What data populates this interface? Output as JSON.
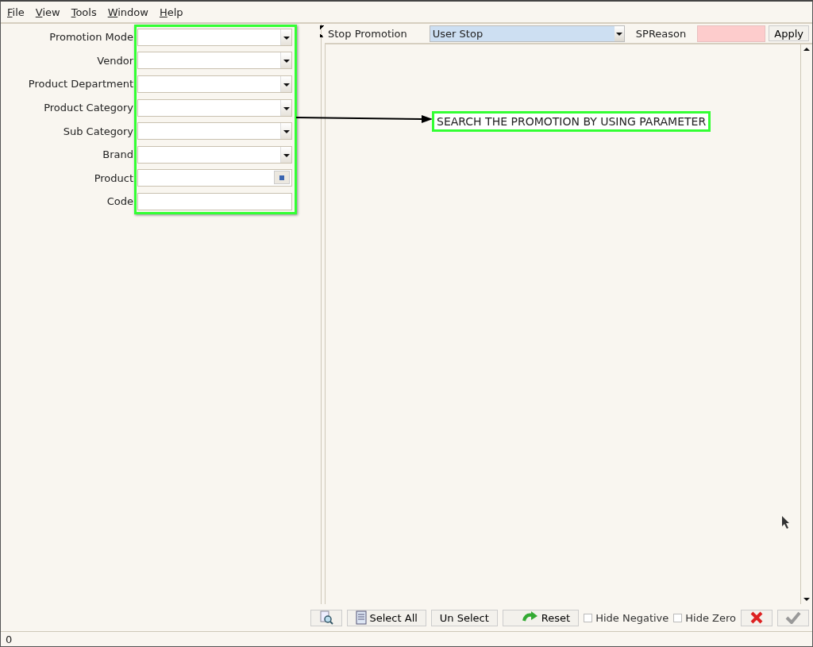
{
  "menu": [
    "File",
    "View",
    "Tools",
    "Window",
    "Help"
  ],
  "filters": [
    {
      "label": "Promotion Mode",
      "kind": "dropdown"
    },
    {
      "label": "Vendor",
      "kind": "dropdown"
    },
    {
      "label": "Product Department",
      "kind": "dropdown"
    },
    {
      "label": "Product Category",
      "kind": "dropdown"
    },
    {
      "label": "Sub Category",
      "kind": "dropdown"
    },
    {
      "label": "Brand",
      "kind": "dropdown"
    },
    {
      "label": "Product",
      "kind": "lookup"
    },
    {
      "label": "Code",
      "kind": "text"
    }
  ],
  "annotation": {
    "text": "SEARCH THE PROMOTION BY USING PARAMETER"
  },
  "stop_bar": {
    "label": "Stop Promotion",
    "value": "User Stop",
    "reason_label": "SPReason",
    "apply": "Apply"
  },
  "toolbar": {
    "select_all": "Select All",
    "unselect": "Un Select",
    "reset": "Reset",
    "options": [
      {
        "label": "Hide Negative",
        "checked": false
      },
      {
        "label": "Hide Zero",
        "checked": false
      }
    ]
  },
  "status_bar": "0"
}
